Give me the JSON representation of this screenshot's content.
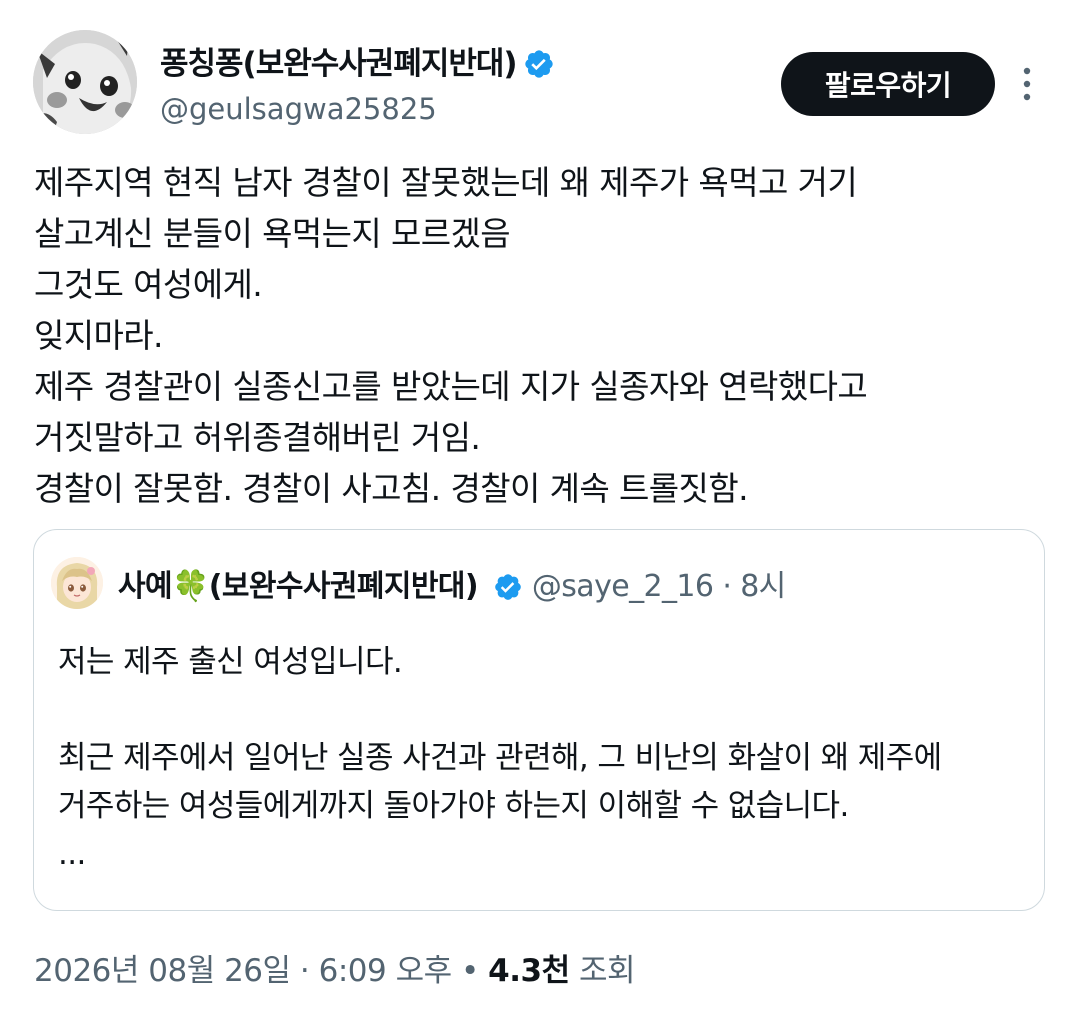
{
  "author": {
    "display_name": "퐁칭퐁(보완수사권폐지반대)",
    "handle": "@geulsagwa25825",
    "verified_icon": "verified-badge-icon",
    "avatar_icon": "pikachu-avatar"
  },
  "actions": {
    "follow_label": "팔로우하기",
    "more_icon": "more-vertical-icon"
  },
  "tweet": {
    "lines": [
      "제주지역 현직 남자 경찰이 잘못했는데 왜 제주가 욕먹고 거기",
      "살고계신 분들이 욕먹는지 모르겠음",
      "그것도 여성에게.",
      "잊지마라.",
      "제주 경찰관이 실종신고를 받았는데 지가 실종자와 연락했다고",
      "거짓말하고 허위종결해버린 거임.",
      "경찰이 잘못함. 경찰이 사고침. 경찰이 계속 트롤짓함."
    ]
  },
  "quote": {
    "display_name": "사예",
    "name_emoji": "🍀",
    "name_suffix": "(보완수사권폐지반대)",
    "handle": "@saye_2_16",
    "separator": "·",
    "time": "8시",
    "lines": [
      "저는 제주 출신 여성입니다.",
      "",
      "최근 제주에서 일어난 실종 사건과 관련해, 그 비난의 화살이 왜 제주에",
      "거주하는 여성들에게까지 돌아가야 하는지 이해할 수 없습니다.",
      "..."
    ]
  },
  "meta": {
    "date": "2026년 08월 26일",
    "separator1": "·",
    "time": "6:09 오후",
    "separator2": "•",
    "views_count": "4.3천",
    "views_label": "조회"
  },
  "colors": {
    "text_primary": "#0f1419",
    "text_secondary": "#536471",
    "verified_blue": "#1d9bf0",
    "border": "#cfd9de",
    "button_bg": "#0f1419"
  }
}
